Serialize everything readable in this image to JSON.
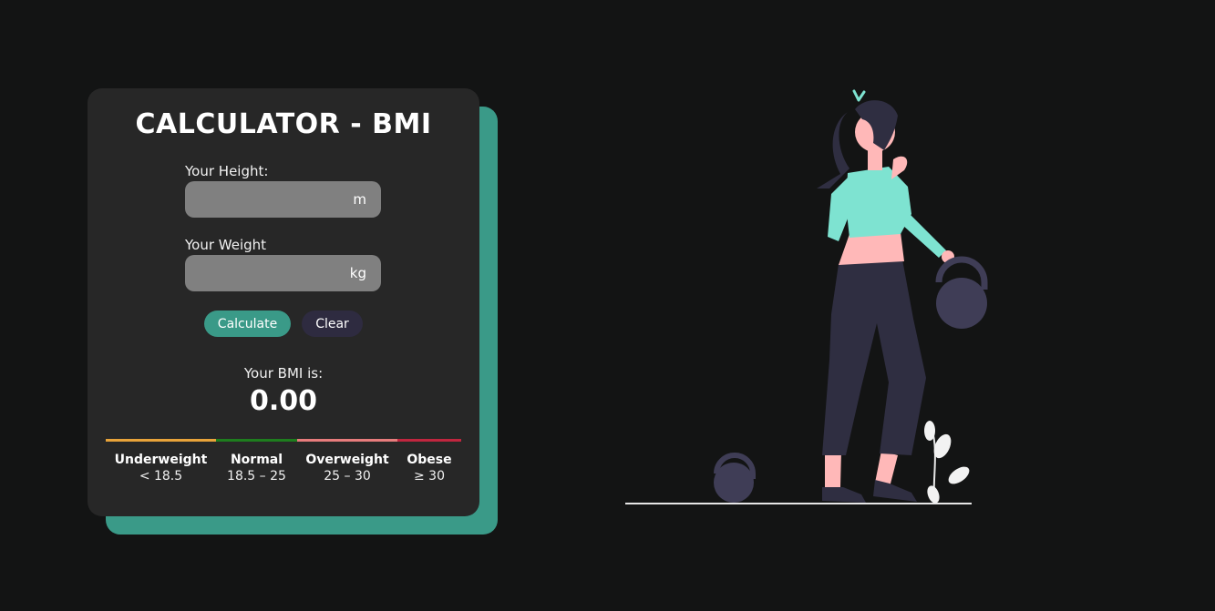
{
  "calculator": {
    "title": "CALCULATOR - BMI",
    "height": {
      "label": "Your Height:",
      "value": "",
      "unit": "m"
    },
    "weight": {
      "label": "Your Weight",
      "value": "",
      "unit": "kg"
    },
    "calculate_label": "Calculate",
    "clear_label": "Clear",
    "result_label": "Your BMI is:",
    "result_value": "0.00",
    "categories": [
      {
        "name": "Underweight",
        "range": "< 18.5",
        "color": "#e8a33a"
      },
      {
        "name": "Normal",
        "range": "18.5 – 25",
        "color": "#1e7d1e"
      },
      {
        "name": "Overweight",
        "range": "25 – 30",
        "color": "#e77c7c"
      },
      {
        "name": "Obese",
        "range": "≥ 30",
        "color": "#c0263f"
      }
    ]
  },
  "colors": {
    "background": "#131414",
    "card": "#272727",
    "accent": "#3a9a88",
    "secondary_button": "#2e2b40",
    "input": "#808080"
  }
}
